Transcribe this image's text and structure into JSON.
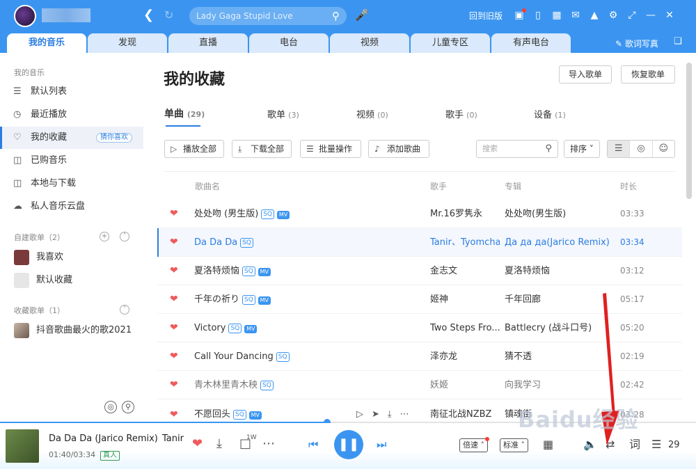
{
  "header": {
    "search_placeholder": "Lady Gaga Stupid Love",
    "old_version": "回到旧版",
    "tabs": [
      {
        "label": "我的音乐"
      },
      {
        "label": "发现"
      },
      {
        "label": "直播"
      },
      {
        "label": "电台"
      },
      {
        "label": "视频"
      },
      {
        "label": "儿童专区"
      },
      {
        "label": "有声电台"
      }
    ],
    "lyrics_poster": "歌词写真"
  },
  "sidebar": {
    "my_music_title": "我的音乐",
    "items": [
      {
        "label": "默认列表"
      },
      {
        "label": "最近播放"
      },
      {
        "label": "我的收藏",
        "badge": "猜你喜欢"
      },
      {
        "label": "已购音乐"
      },
      {
        "label": "本地与下载"
      },
      {
        "label": "私人音乐云盘"
      }
    ],
    "created_title": "自建歌单（2）",
    "created": [
      {
        "label": "我喜欢"
      },
      {
        "label": "默认收藏"
      }
    ],
    "collected_title": "收藏歌单（1）",
    "collected": [
      {
        "label": "抖音歌曲最火的歌2021"
      }
    ]
  },
  "main": {
    "title": "我的收藏",
    "import_btn": "导入歌单",
    "restore_btn": "恢复歌单",
    "tabs": [
      {
        "label": "单曲",
        "count": "(29)"
      },
      {
        "label": "歌单",
        "count": "(3)"
      },
      {
        "label": "视频",
        "count": "(0)"
      },
      {
        "label": "歌手",
        "count": "(0)"
      },
      {
        "label": "设备",
        "count": "(1)"
      }
    ],
    "actions": {
      "play_all": "播放全部",
      "download_all": "下载全部",
      "batch": "批量操作",
      "add_song": "添加歌曲"
    },
    "search_placeholder": "搜索",
    "sort": "排序",
    "columns": {
      "song": "歌曲名",
      "artist": "歌手",
      "album": "专辑",
      "duration": "时长"
    },
    "songs": [
      {
        "title": "处处吻 (男生版)",
        "artist": "Mr.16罗隽永",
        "album": "处处吻(男生版)",
        "duration": "03:33"
      },
      {
        "title": "Da Da Da",
        "artist": "Tanir、Tyomcha",
        "album": "Да да да(Jarico Remix)",
        "duration": "03:34"
      },
      {
        "title": "夏洛特烦恼",
        "artist": "金志文",
        "album": "夏洛特烦恼",
        "duration": "03:12"
      },
      {
        "title": "千年の祈り",
        "artist": "姬神",
        "album": "千年回廊",
        "duration": "05:17"
      },
      {
        "title": "Victory",
        "artist": "Two Steps Fro...",
        "album": "Battlecry (战斗口号)",
        "duration": "05:20"
      },
      {
        "title": "Call Your Dancing",
        "artist": "泽亦龙",
        "album": "猜不透",
        "duration": "02:19"
      },
      {
        "title": "青木林里青木秧",
        "artist": "妖姬",
        "album": "向我学习",
        "duration": "02:42"
      },
      {
        "title": "不愿回头",
        "artist": "南征北战NZBZ",
        "album": "镇魂街",
        "duration": "03:28"
      }
    ],
    "badges": {
      "sq": "SQ",
      "mv": "MV"
    }
  },
  "player": {
    "song": "Da Da Da (Jarico Remix)",
    "artist": "Tanir",
    "time": "01:40/03:34",
    "tag": "真人",
    "comment_count": "1W",
    "speed": "倍速",
    "quality": "标准",
    "lyric": "词",
    "queue_count": "29",
    "progress": 0.47
  },
  "watermark": "Baidu经验",
  "colors": {
    "accent": "#3b95f0",
    "heart": "#ef5a5a",
    "annotation": "#e02020"
  }
}
